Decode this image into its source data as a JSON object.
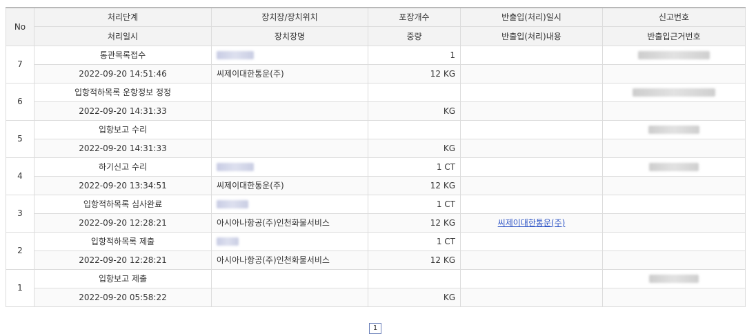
{
  "header": {
    "no": "No",
    "row1": [
      "처리단계",
      "장치장/장치위치",
      "포장개수",
      "반출입(처리)일시",
      "신고번호"
    ],
    "row2": [
      "처리일시",
      "장치장명",
      "중량",
      "반출입(처리)내용",
      "반출입근거번호"
    ]
  },
  "rows": [
    {
      "no": "7",
      "stage": "통관목록접수",
      "datetime": "2022-09-20 14:51:46",
      "location_redacted": true,
      "warehouse": "씨제이대한통운(주)",
      "packages": "1",
      "weight": "12 KG",
      "io_datetime": "",
      "io_content": "",
      "report_redacted": true,
      "basis_redacted": false
    },
    {
      "no": "6",
      "stage": "입항적하목록 운항정보 정정",
      "datetime": "2022-09-20 14:31:33",
      "location_redacted": false,
      "warehouse": "",
      "packages": "",
      "weight": "KG",
      "io_datetime": "",
      "io_content": "",
      "report_redacted": true,
      "basis_redacted": false
    },
    {
      "no": "5",
      "stage": "입항보고 수리",
      "datetime": "2022-09-20 14:31:33",
      "location_redacted": false,
      "warehouse": "",
      "packages": "",
      "weight": "KG",
      "io_datetime": "",
      "io_content": "",
      "report_redacted": true,
      "basis_redacted": false
    },
    {
      "no": "4",
      "stage": "하기신고 수리",
      "datetime": "2022-09-20 13:34:51",
      "location_redacted": true,
      "warehouse": "씨제이대한통운(주)",
      "packages": "1 CT",
      "weight": "12 KG",
      "io_datetime": "",
      "io_content": "",
      "report_redacted": true,
      "basis_redacted": false
    },
    {
      "no": "3",
      "stage": "입항적하목록 심사완료",
      "datetime": "2022-09-20 12:28:21",
      "location_redacted": true,
      "warehouse": "아시아나항공(주)인천화물서비스",
      "packages": "1 CT",
      "weight": "12 KG",
      "io_datetime": "",
      "io_content": "씨제이대한통운(주)",
      "report_redacted": false,
      "basis_redacted": false
    },
    {
      "no": "2",
      "stage": "입항적하목록 제출",
      "datetime": "2022-09-20 12:28:21",
      "location_redacted": true,
      "warehouse": "아시아나항공(주)인천화물서비스",
      "packages": "1 CT",
      "weight": "12 KG",
      "io_datetime": "",
      "io_content": "",
      "report_redacted": false,
      "basis_redacted": false
    },
    {
      "no": "1",
      "stage": "입항보고 제출",
      "datetime": "2022-09-20 05:58:22",
      "location_redacted": false,
      "warehouse": "",
      "packages": "",
      "weight": "KG",
      "io_datetime": "",
      "io_content": "",
      "report_redacted": true,
      "basis_redacted": false
    }
  ],
  "pagination": {
    "current": "1"
  },
  "colors": {
    "header_bg": "#f3f3f3",
    "border": "#dcdcdc",
    "link": "#2f55c6"
  }
}
